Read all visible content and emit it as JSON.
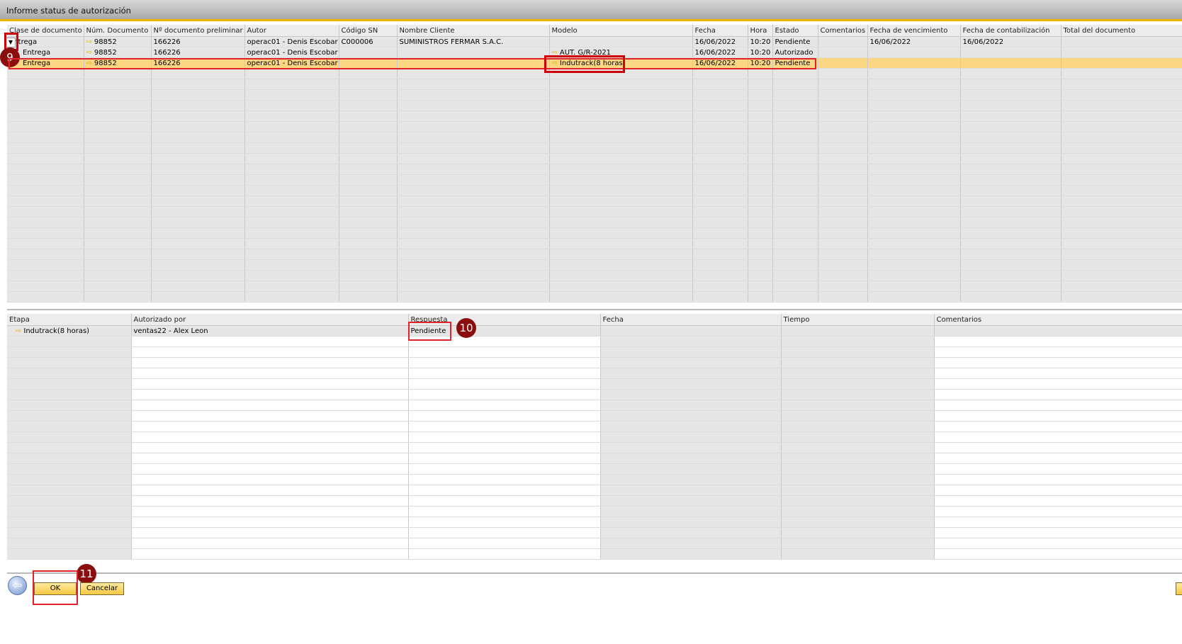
{
  "window": {
    "title": "Informe status de autorización"
  },
  "top_grid": {
    "columns": [
      "Clase de documento",
      "Núm. Documento",
      "Nº documento preliminar",
      "Autor",
      "Código SN",
      "Nombre Cliente",
      "Modelo",
      "Fecha",
      "Hora",
      "Estado",
      "Comentarios",
      "Fecha de vencimiento",
      "Fecha de contabilización",
      "Total del documento"
    ],
    "rows": [
      {
        "clase": "Entrega",
        "num": "98852",
        "prelim": "166226",
        "autor": "operac01 - Denis Escobar",
        "codigo": "C000006",
        "cliente": "SUMINISTROS FERMAR S.A.C.",
        "modelo": "",
        "fecha": "16/06/2022",
        "hora": "10:20",
        "estado": "Pendiente",
        "coment": "",
        "venc": "16/06/2022",
        "contab": "16/06/2022",
        "total": ""
      },
      {
        "clase": "Entrega",
        "num": "98852",
        "prelim": "166226",
        "autor": "operac01 - Denis Escobar",
        "codigo": "",
        "cliente": "",
        "modelo": "AUT. G/R-2021",
        "fecha": "16/06/2022",
        "hora": "10:20",
        "estado": "Autorizado",
        "coment": "",
        "venc": "",
        "contab": "",
        "total": ""
      },
      {
        "clase": "Entrega",
        "num": "98852",
        "prelim": "166226",
        "autor": "operac01 - Denis Escobar",
        "codigo": "",
        "cliente": "",
        "modelo": "Indutrack(8 horas)",
        "fecha": "16/06/2022",
        "hora": "10:20",
        "estado": "Pendiente",
        "coment": "",
        "venc": "",
        "contab": "",
        "total": ""
      }
    ]
  },
  "bottom_grid": {
    "columns": [
      "Etapa",
      "Autorizado por",
      "Respuesta",
      "Fecha",
      "Tiempo",
      "Comentarios"
    ],
    "rows": [
      {
        "etapa": "Indutrack(8 horas)",
        "autorizado": "ventas22 - Alex Leon",
        "respuesta": "Pendiente",
        "fecha": "",
        "tiempo": "",
        "coment": ""
      }
    ]
  },
  "annotations": {
    "step9": "9",
    "step10": "10",
    "step11": "11"
  },
  "buttons": {
    "ok": "OK",
    "cancel": "Cancelar"
  },
  "colors": {
    "highlight_row": "#fbd783",
    "accent": "#f0b400",
    "annotation_red": "#e0222a",
    "badge": "#8b0e0e"
  }
}
